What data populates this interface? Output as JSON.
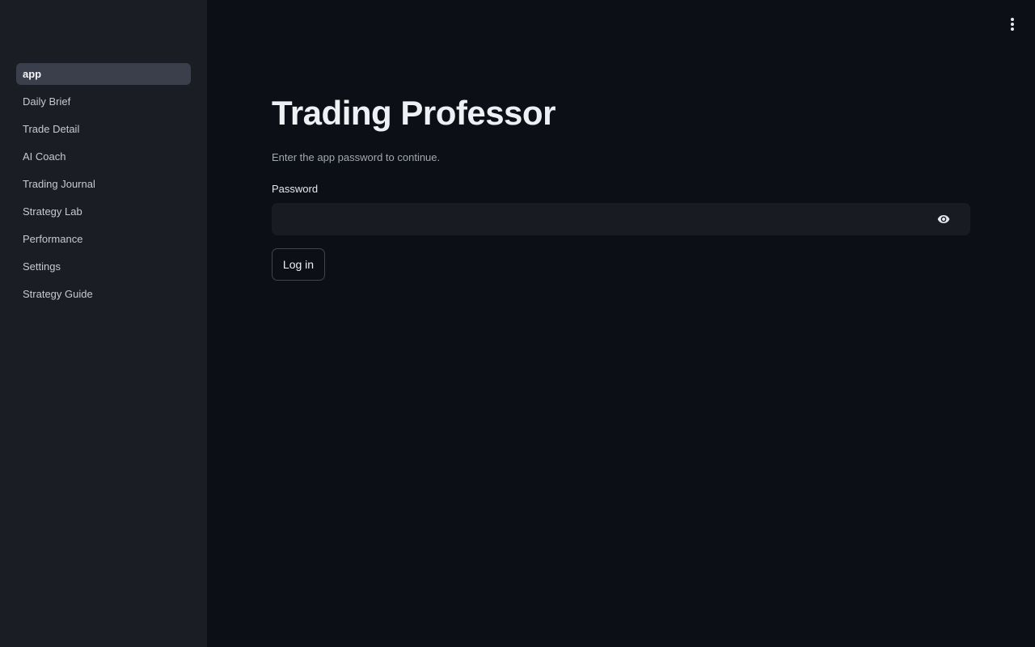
{
  "sidebar": {
    "items": [
      {
        "label": "app",
        "active": true
      },
      {
        "label": "Daily Brief"
      },
      {
        "label": "Trade Detail"
      },
      {
        "label": "AI Coach"
      },
      {
        "label": "Trading Journal"
      },
      {
        "label": "Strategy Lab"
      },
      {
        "label": "Performance"
      },
      {
        "label": "Settings"
      },
      {
        "label": "Strategy Guide"
      }
    ]
  },
  "header": {
    "menu_icon": "more-vertical-icon"
  },
  "main": {
    "title": "Trading Professor",
    "subtitle": "Enter the app password to continue.",
    "password": {
      "label": "Password",
      "value": "",
      "placeholder": "",
      "toggle_icon": "eye-icon"
    },
    "login_label": "Log in"
  },
  "colors": {
    "background": "#0c0f16",
    "sidebar": "#1a1d24",
    "active_item": "#3a3f4b",
    "input_bg": "#181b22"
  }
}
